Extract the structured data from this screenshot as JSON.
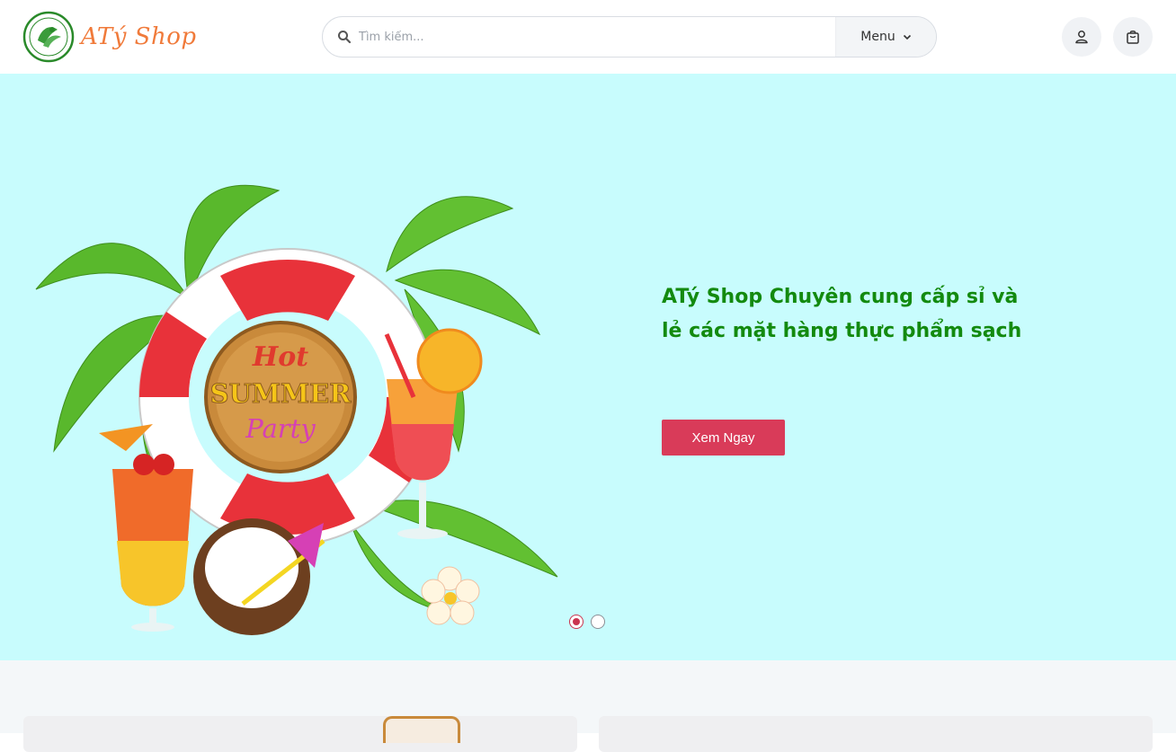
{
  "header": {
    "logo_text": "ATý Shop",
    "search_placeholder": "Tìm kiếm...",
    "menu_label": "Menu"
  },
  "hero": {
    "art_text": {
      "hot": "Hot",
      "summer": "SUMMER",
      "party": "Party"
    },
    "title": "ATý Shop Chuyên cung cấp sỉ và lẻ các mặt hàng thực phẩm sạch",
    "cta_label": "Xem Ngay",
    "slides": {
      "count": 2,
      "active": 1
    }
  },
  "colors": {
    "hero_background": "#c8fcfd",
    "title_green": "#138a0f",
    "cta_red": "#d93b59",
    "logo_orange": "#f07a3a"
  },
  "icons": {
    "search": "search-icon",
    "menu_chevron": "chevron-down-icon",
    "user": "user-icon",
    "bag": "shopping-bag-icon"
  }
}
